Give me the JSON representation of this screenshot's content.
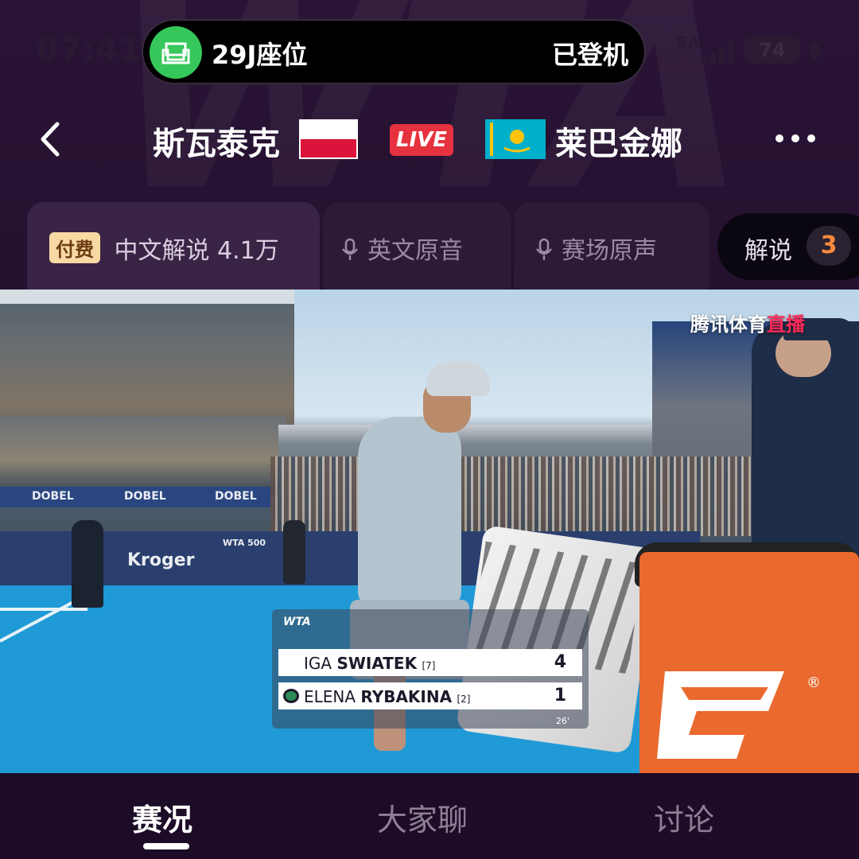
{
  "status_bar": {
    "time": "07:41",
    "signal_label": "5A",
    "battery": "74",
    "island": {
      "seat": "29J座位",
      "status": "已登机",
      "icon": "seat-icon"
    }
  },
  "header": {
    "player_left": "斯瓦泰克",
    "player_left_flag": "poland-flag",
    "live_label": "LIVE",
    "player_right": "莱巴金娜",
    "player_right_flag": "kazakhstan-flag"
  },
  "audio_tabs": [
    {
      "badge": "付费",
      "label": "中文解说",
      "count": "4.1万",
      "active": true
    },
    {
      "label": "英文原音",
      "icon": "mic-icon",
      "active": false
    },
    {
      "label": "赛场原声",
      "icon": "mic-icon",
      "active": false
    }
  ],
  "commentary": {
    "label": "解说",
    "count": "3"
  },
  "video": {
    "broadcaster": "腾讯体育",
    "broadcaster_tag": "直播",
    "ads": [
      "DOBEL",
      "DOBEL",
      "DOBEL",
      "Kroger",
      "WTA 500"
    ],
    "scoreboard": {
      "brand": "WTA",
      "players": [
        {
          "first": "IGA",
          "last": "SWIATEK",
          "seed": "[7]",
          "score": "4",
          "serving": false
        },
        {
          "first": "ELENA",
          "last": "RYBAKINA",
          "seed": "[2]",
          "score": "1",
          "serving": true
        }
      ],
      "elapsed": "26'"
    }
  },
  "bottom_nav": [
    {
      "label": "赛况",
      "active": true
    },
    {
      "label": "大家聊",
      "active": false
    },
    {
      "label": "讨论",
      "active": false
    }
  ],
  "colors": {
    "background": "#23102e",
    "live": "#e5323e",
    "accent_orange": "#ff8a3d",
    "court_blue": "#1f9ad6"
  }
}
